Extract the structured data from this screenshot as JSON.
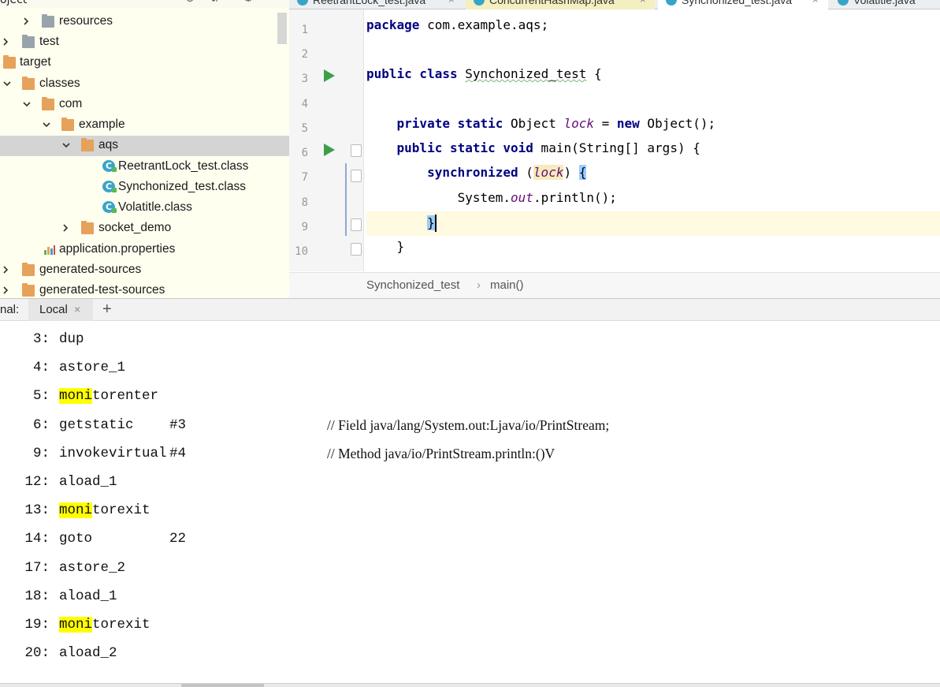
{
  "project_panel": {
    "title": "oject",
    "items": [
      {
        "label": "resources",
        "icon": "resources-folder-icon",
        "expanded": false
      },
      {
        "label": "test",
        "icon": "folder-icon",
        "expanded": false
      },
      {
        "label": "target",
        "icon": "folder-icon",
        "expanded": true
      },
      {
        "label": "classes",
        "icon": "folder-icon",
        "expanded": true
      },
      {
        "label": "com",
        "icon": "folder-icon",
        "expanded": true
      },
      {
        "label": "example",
        "icon": "folder-icon",
        "expanded": true
      },
      {
        "label": "aqs",
        "icon": "folder-icon",
        "expanded": true,
        "selected": true
      },
      {
        "label": "ReetrantLock_test.class",
        "icon": "class-file-icon"
      },
      {
        "label": "Synchonized_test.class",
        "icon": "class-file-icon"
      },
      {
        "label": "Volatitle.class",
        "icon": "class-file-icon"
      },
      {
        "label": "socket_demo",
        "icon": "folder-icon",
        "expanded": false
      },
      {
        "label": "application.properties",
        "icon": "properties-file-icon"
      },
      {
        "label": "generated-sources",
        "icon": "folder-icon",
        "expanded": false
      },
      {
        "label": "generated-test-sources",
        "icon": "folder-icon",
        "expanded": false
      }
    ]
  },
  "editor": {
    "tabs": [
      {
        "label": "ReetrantLock_test.java"
      },
      {
        "label": "ConcurrentHashMap.java"
      },
      {
        "label": "Synchonized_test.java",
        "active": true
      },
      {
        "label": "Volatitle.java"
      }
    ],
    "line_numbers": [
      "1",
      "2",
      "3",
      "4",
      "5",
      "6",
      "7",
      "8",
      "9",
      "10"
    ],
    "code": {
      "l1_kw": "package",
      "l1_rest": " com.example.aqs;",
      "l3_kw": "public class",
      "l3_name": "Synchonized_test",
      "l3_rest": " {",
      "l5_kw1": "private static",
      "l5_type": " Object ",
      "l5_field": "lock",
      "l5_eq": " = ",
      "l5_kw2": "new",
      "l5_rest": " Object();",
      "l6_kw": "public static void",
      "l6_rest": " main(String[] args) {",
      "l7_kw": "synchronized",
      "l7_open": " (",
      "l7_field": "lock",
      "l7_close": ") ",
      "l7_brace": "{",
      "l8_pre": "System.",
      "l8_field": "out",
      "l8_rest": ".println();",
      "l9_brace": "}",
      "l10_brace": "}"
    },
    "breadcrumb": [
      "Synchonized_test",
      "main()"
    ],
    "breadcrumb_sep": "›"
  },
  "terminal": {
    "tab_prefix": "nal:",
    "tab_label": "Local",
    "tab_close": "×",
    "add_label": "+",
    "highlight_color": "#ffff00",
    "lines": [
      {
        "num": "3:",
        "hl": "",
        "instr": "dup",
        "arg": "",
        "comment": ""
      },
      {
        "num": "4:",
        "hl": "",
        "instr": "astore_1",
        "arg": "",
        "comment": ""
      },
      {
        "num": "5:",
        "hl": "moni",
        "instr": "torenter",
        "arg": "",
        "comment": ""
      },
      {
        "num": "6:",
        "hl": "",
        "instr": "getstatic",
        "arg": "#3",
        "comment": "// Field java/lang/System.out:Ljava/io/PrintStream;"
      },
      {
        "num": "9:",
        "hl": "",
        "instr": "invokevirtual",
        "arg": "#4",
        "comment": "// Method java/io/PrintStream.println:()V"
      },
      {
        "num": "12:",
        "hl": "",
        "instr": "aload_1",
        "arg": "",
        "comment": ""
      },
      {
        "num": "13:",
        "hl": "moni",
        "instr": "torexit",
        "arg": "",
        "comment": ""
      },
      {
        "num": "14:",
        "hl": "",
        "instr": "goto",
        "arg": "22",
        "comment": ""
      },
      {
        "num": "17:",
        "hl": "",
        "instr": "astore_2",
        "arg": "",
        "comment": ""
      },
      {
        "num": "18:",
        "hl": "",
        "instr": "aload_1",
        "arg": "",
        "comment": ""
      },
      {
        "num": "19:",
        "hl": "moni",
        "instr": "torexit",
        "arg": "",
        "comment": ""
      },
      {
        "num": "20:",
        "hl": "",
        "instr": "aload_2",
        "arg": "",
        "comment": ""
      }
    ]
  }
}
